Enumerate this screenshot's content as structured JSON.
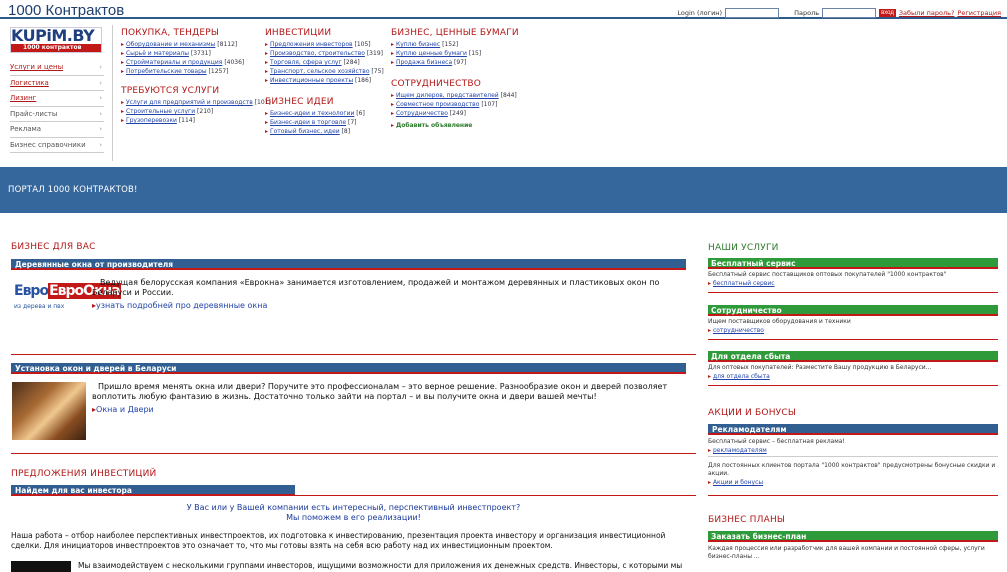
{
  "site": {
    "title": "1000 Контрактов"
  },
  "login": {
    "login_label": "Login (логин)",
    "password_label": "Пароль",
    "go_label": "вход",
    "forgot": "Забыли пароль?",
    "register": "Регистрация"
  },
  "logo": {
    "line1": "KUPiM.BY",
    "line2": "1000 контрактов"
  },
  "leftnav": {
    "items": [
      "Услуги и цены",
      "Логистика",
      "Лизинг",
      "Прайс-листы",
      "Реклама",
      "Бизнес справочники"
    ]
  },
  "categories": {
    "pokupka": {
      "title": "ПОКУПКА, ТЕНДЕРЫ",
      "links": [
        [
          "Оборудование и механизмы",
          "[8112]"
        ],
        [
          "Сырьё и материалы",
          "[3731]"
        ],
        [
          "Стройматериалы и продукция",
          "[4036]"
        ],
        [
          "Потребительские товары",
          "[1257]"
        ]
      ]
    },
    "uslugi": {
      "title": "ТРЕБУЮТСЯ УСЛУГИ",
      "links": [
        [
          "Услуги для предприятий и производств",
          "[101]"
        ],
        [
          "Строительные услуги",
          "[210]"
        ],
        [
          "Грузоперевозки",
          "[114]"
        ]
      ]
    },
    "invest": {
      "title": "ИНВЕСТИЦИИ",
      "links": [
        [
          "Предложения инвесторов",
          "[105]"
        ],
        [
          "Производство, строительство",
          "[319]"
        ],
        [
          "Торговля, сфера услуг",
          "[284]"
        ],
        [
          "Транспорт, сельское хозяйство",
          "[75]"
        ],
        [
          "Инвестиционные проекты",
          "[186]"
        ]
      ]
    },
    "ideas": {
      "title": "БИЗНЕС ИДЕИ",
      "links": [
        [
          "Бизнес-идеи и технологии",
          "[6]"
        ],
        [
          "Бизнес-идеи в торговле",
          "[7]"
        ],
        [
          "Готовый бизнес, идеи",
          "[8]"
        ]
      ]
    },
    "cb": {
      "title": "БИЗНЕС, ЦЕННЫЕ БУМАГИ",
      "links": [
        [
          "Куплю бизнес",
          "[152]"
        ],
        [
          "Куплю ценные бумаги",
          "[15]"
        ],
        [
          "Продажа бизнеса",
          "[97]"
        ]
      ]
    },
    "coop": {
      "title": "СОТРУДНИЧЕСТВО",
      "links": [
        [
          "Ищем дилеров, представителей",
          "[844]"
        ],
        [
          "Совместное производство",
          "[107]"
        ],
        [
          "Сотрудничество",
          "[249]"
        ]
      ],
      "add": "Добавить объявление"
    }
  },
  "banner": {
    "text": "ПОРТАЛ 1000 КОНТРАКТОВ!"
  },
  "business": {
    "title": "БИЗНЕС ДЛЯ ВАС",
    "b1": {
      "bar": "Деревянные окна от производителя",
      "text": "Ведущая белорусская компания «Еврокна» занимается изготовлением, продажей и монтажом деревянных и пластиковых окон по Беларуси и России.",
      "link": "узнать подробней про деревянные окна",
      "logo_top": "ЕвроОкна",
      "logo_sub": "из дерева и пвх"
    },
    "b2": {
      "bar": "Установка окон и дверей в Беларуси",
      "text": "Пришло время менять окна или двери? Поручите это профессионалам – это верное решение. Разнообразие окон и дверей позволяет воплотить любую фантазию в жизнь. Достаточно только зайти на портал – и вы получите окна и двери вашей мечты!",
      "link": "Окна и Двери"
    }
  },
  "invest_offers": {
    "title": "ПРЕДЛОЖЕНИЯ ИНВЕСТИЦИЙ",
    "bar": "Найдем для вас инвестора",
    "q1": "У Вас или у Вашей компании есть интересный, перспективный инвестпроект?",
    "q2": "Мы поможем в его реализации!",
    "p1": "Наша работа – отбор наиболее перспективных инвестпроектов, их подготовка к инвестированию, презентация проекта инвестору и организация инвестиционной сделки. Для инициаторов инвестпроектов это означает то, что мы готовы взять на себя всю работу над их инвестиционным проектом.",
    "p2": "Мы взаимодействуем с несколькими группами инвесторов, ищущими возможности для приложения их денежных средств. Инвесторы, с которыми мы"
  },
  "right": {
    "services_title": "НАШИ УСЛУГИ",
    "s1": {
      "bar": "Бесплатный сервис",
      "text": "Бесплатный сервис поставщиков оптовых покупателей \"1000 контрактов\"",
      "link": "бесплатный сервис"
    },
    "s2": {
      "bar": "Сотрудничество",
      "text": "Ищем поставщиков оборудования и техники",
      "link": "сотрудничество"
    },
    "s3": {
      "bar": "Для отдела сбыта",
      "text": "Для оптовых покупателей: Разместите Вашу продукцию в Беларуси...",
      "link": "для отдела сбыта"
    },
    "promo_title": "АКЦИИ И БОНУСЫ",
    "p1": {
      "bar": "Рекламодателям",
      "text": "Бесплатный сервис – бесплатная реклама!",
      "link": "рекламодателям",
      "text2": "Для постоянных клиентов портала \"1000 контрактов\" предусмотрены бонусные скидки и акции.",
      "link2": "Акции и бонусы"
    },
    "plans_title": "БИЗНЕС ПЛАНЫ",
    "bp": {
      "bar": "Заказать бизнес-план",
      "text": "Каждая процессия или разработчик для вашей компании и постоянной сферы, услуги бизнес-планы ..."
    }
  }
}
